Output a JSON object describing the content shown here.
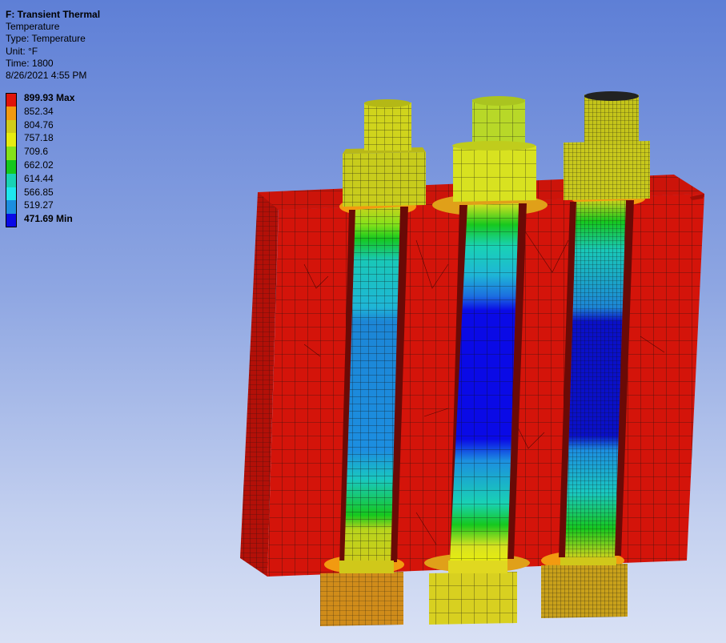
{
  "result": {
    "title": "F: Transient Thermal",
    "lines": [
      "Temperature",
      "Type: Temperature",
      "Unit: °F",
      "Time: 1800",
      "8/26/2021 4:55 PM"
    ]
  },
  "legend": {
    "entries": [
      {
        "label": "899.93 Max",
        "color": "#e0140a"
      },
      {
        "label": "852.34",
        "color": "#f29a10"
      },
      {
        "label": "804.76",
        "color": "#d0cc1a"
      },
      {
        "label": "757.18",
        "color": "#e6ec10"
      },
      {
        "label": "709.6",
        "color": "#84e21a"
      },
      {
        "label": "662.02",
        "color": "#16c81e"
      },
      {
        "label": "614.44",
        "color": "#19d2b4"
      },
      {
        "label": "566.85",
        "color": "#1ee6ee"
      },
      {
        "label": "519.27",
        "color": "#1c8ee0"
      },
      {
        "label": "471.69 Min",
        "color": "#0a0ae6"
      }
    ]
  }
}
